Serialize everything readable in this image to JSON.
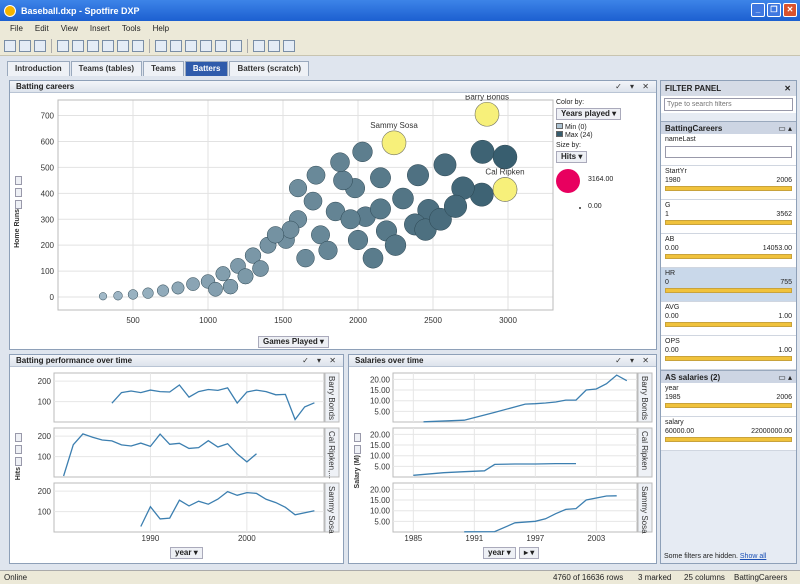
{
  "window": {
    "title": "Baseball.dxp - Spotfire DXP"
  },
  "menu": [
    "File",
    "Edit",
    "View",
    "Insert",
    "Tools",
    "Help"
  ],
  "tabs": [
    {
      "label": "Introduction"
    },
    {
      "label": "Teams (tables)"
    },
    {
      "label": "Teams"
    },
    {
      "label": "Batters",
      "active": true
    },
    {
      "label": "Batters (scratch)"
    }
  ],
  "scatter": {
    "title": "Batting careers",
    "xaxis_label": "Games Played",
    "yaxis_label": "Home Runs",
    "color_by_label": "Color by:",
    "color_by": "Years played",
    "legend_min": "Min (0)",
    "legend_max": "Max (24)",
    "size_by_label": "Size by:",
    "size_by": "Hits",
    "size_max": "3164.00",
    "size_min": "0.00",
    "colors": {
      "low": "#adc3d2",
      "high": "#375d6e",
      "highlight": "#f7f07a",
      "marked": "#e8005f"
    }
  },
  "chart_data": [
    {
      "type": "scatter",
      "title": "Batting careers",
      "xlabel": "Games Played",
      "ylabel": "Home Runs",
      "xlim": [
        0,
        3300
      ],
      "ylim": [
        -50,
        760
      ],
      "xticks": [
        500,
        1000,
        1500,
        2000,
        2500,
        3000
      ],
      "yticks": [
        0,
        100,
        200,
        300,
        400,
        500,
        600,
        700
      ],
      "annotations": [
        {
          "label": "Sammy Sosa",
          "x": 2240,
          "y": 595
        },
        {
          "label": "Barry Bonds",
          "x": 2860,
          "y": 705
        },
        {
          "label": "Cal Ripken",
          "x": 2980,
          "y": 415
        }
      ],
      "points": [
        [
          2860,
          705
        ],
        [
          2240,
          595
        ],
        [
          2980,
          415
        ],
        [
          2830,
          560
        ],
        [
          2825,
          395
        ],
        [
          2470,
          335
        ],
        [
          2980,
          540
        ],
        [
          2400,
          470
        ],
        [
          2580,
          510
        ],
        [
          2300,
          380
        ],
        [
          2150,
          460
        ],
        [
          1980,
          420
        ],
        [
          2050,
          310
        ],
        [
          2190,
          255
        ],
        [
          2380,
          280
        ],
        [
          1700,
          370
        ],
        [
          1850,
          330
        ],
        [
          1900,
          450
        ],
        [
          1600,
          300
        ],
        [
          1750,
          240
        ],
        [
          1520,
          220
        ],
        [
          1650,
          150
        ],
        [
          1400,
          200
        ],
        [
          1300,
          160
        ],
        [
          1200,
          120
        ],
        [
          1100,
          90
        ],
        [
          1000,
          60
        ],
        [
          900,
          50
        ],
        [
          800,
          35
        ],
        [
          700,
          25
        ],
        [
          600,
          15
        ],
        [
          500,
          10
        ],
        [
          400,
          5
        ],
        [
          300,
          3
        ],
        [
          1800,
          180
        ],
        [
          2000,
          220
        ],
        [
          2100,
          150
        ],
        [
          2250,
          200
        ],
        [
          2450,
          260
        ],
        [
          2550,
          300
        ],
        [
          1550,
          260
        ],
        [
          1450,
          240
        ],
        [
          1950,
          300
        ],
        [
          2150,
          340
        ],
        [
          1350,
          110
        ],
        [
          1250,
          80
        ],
        [
          1150,
          40
        ],
        [
          1050,
          30
        ],
        [
          2700,
          420
        ],
        [
          2650,
          350
        ],
        [
          1880,
          520
        ],
        [
          2030,
          560
        ],
        [
          1720,
          470
        ],
        [
          1600,
          420
        ]
      ]
    },
    {
      "type": "line",
      "title": "Batting performance over time",
      "xlabel": "year",
      "ylabel": "Hits",
      "xticks": [
        1990,
        2000
      ],
      "series": [
        {
          "name": "Barry Bonds",
          "x": [
            1986,
            1987,
            1988,
            1989,
            1990,
            1991,
            1992,
            1993,
            1994,
            1995,
            1996,
            1997,
            1998,
            1999,
            2000,
            2001,
            2002,
            2003,
            2004,
            2005,
            2006,
            2007
          ],
          "values": [
            92,
            144,
            152,
            144,
            156,
            149,
            147,
            181,
            122,
            149,
            159,
            155,
            167,
            93,
            147,
            156,
            149,
            133,
            135,
            12,
            74,
            94
          ]
        },
        {
          "name": "Cal Ripken",
          "x": [
            1981,
            1982,
            1983,
            1984,
            1985,
            1986,
            1987,
            1988,
            1989,
            1990,
            1991,
            1992,
            1993,
            1994,
            1995,
            1996,
            1997,
            1998,
            1999,
            2000,
            2001
          ],
          "values": [
            5,
            158,
            211,
            195,
            181,
            177,
            157,
            152,
            166,
            150,
            210,
            160,
            165,
            140,
            144,
            178,
            147,
            163,
            113,
            74,
            114
          ]
        },
        {
          "name": "Sammy Sosa",
          "x": [
            1989,
            1990,
            1991,
            1992,
            1993,
            1994,
            1995,
            1996,
            1997,
            1998,
            1999,
            2000,
            2001,
            2002,
            2003,
            2004,
            2005,
            2007
          ],
          "values": [
            27,
            124,
            64,
            68,
            156,
            128,
            151,
            136,
            161,
            198,
            180,
            193,
            189,
            160,
            144,
            121,
            84,
            104
          ]
        }
      ]
    },
    {
      "type": "line",
      "title": "Salaries over time",
      "xlabel": "year",
      "ylabel": "Salary (M)",
      "xticks": [
        1985,
        1991,
        1997,
        2003
      ],
      "series": [
        {
          "name": "Barry Bonds",
          "x": [
            1986,
            1990,
            1993,
            1996,
            1997,
            1998,
            1999,
            2000,
            2001,
            2002,
            2003,
            2004,
            2005,
            2006
          ],
          "values": [
            0.1,
            0.85,
            4.5,
            8.4,
            8.6,
            8.9,
            9.4,
            10.3,
            10.3,
            15,
            15.5,
            18,
            22,
            19.4
          ]
        },
        {
          "name": "Cal Ripken",
          "x": [
            1985,
            1988,
            1990,
            1992,
            1993,
            1995,
            1997,
            1999,
            2001
          ],
          "values": [
            0.8,
            2.0,
            2.5,
            2.9,
            5.9,
            6.1,
            6.1,
            6.3,
            6.3
          ]
        },
        {
          "name": "Sammy Sosa",
          "x": [
            1990,
            1993,
            1995,
            1997,
            1998,
            1999,
            2000,
            2001,
            2002,
            2004,
            2005
          ],
          "values": [
            0.1,
            0.2,
            4.3,
            5.0,
            6.2,
            8.6,
            10.6,
            11,
            15,
            16.9,
            17
          ]
        }
      ]
    }
  ],
  "perf": {
    "title": "Batting performance over time",
    "yaxis_label": "Hits",
    "xaxis_label": "year",
    "ytick": [
      "200",
      "100",
      "200",
      "100",
      "200",
      "100"
    ],
    "xtick": [
      "1990",
      "2000"
    ],
    "strip": [
      "Barry Bonds",
      "Cal Ripken,...",
      "Sammy Sosa"
    ]
  },
  "salary": {
    "title": "Salaries over time",
    "yaxis_label": "Salary (M)",
    "xaxis_label": "year",
    "ytick": [
      "20.00",
      "15.00",
      "10.00",
      "5.00",
      "20.00",
      "15.00",
      "10.00",
      "5.00",
      "20.00",
      "15.00",
      "10.00",
      "5.00"
    ],
    "xtick": [
      "1985",
      "1991",
      "1997",
      "2003"
    ],
    "strip": [
      "Barry Bonds",
      "Cal Ripken",
      "Sammy Sosa"
    ]
  },
  "filter": {
    "title": "FILTER PANEL",
    "search_placeholder": "Type to search filters",
    "group1": "BattingCareers",
    "name_label": "nameLast",
    "items": [
      {
        "label": "StartYr",
        "min": "1980",
        "max": "2006",
        "fill": 1
      },
      {
        "label": "G",
        "min": "1",
        "max": "3562",
        "fill": 1
      },
      {
        "label": "AB",
        "min": "0.00",
        "max": "14053.00",
        "fill": 1
      },
      {
        "label": "HR",
        "min": "0",
        "max": "755",
        "fill": 1
      },
      {
        "label": "AVG",
        "min": "0.00",
        "max": "1.00",
        "fill": 1
      },
      {
        "label": "OPS",
        "min": "0.00",
        "max": "1.00",
        "fill": 1
      }
    ],
    "group2": "AS salaries (2)",
    "items2": [
      {
        "label": "year",
        "min": "1985",
        "max": "2006"
      },
      {
        "label": "salary",
        "min": "60000.00",
        "max": "22000000.00"
      }
    ],
    "hidden_note": "Some filters are hidden.",
    "show_all": "Show all"
  },
  "status": {
    "state": "Online",
    "rows": "4760 of 16636 rows",
    "marked": "3 marked",
    "cols": "25 columns",
    "table": "BattingCareers"
  }
}
